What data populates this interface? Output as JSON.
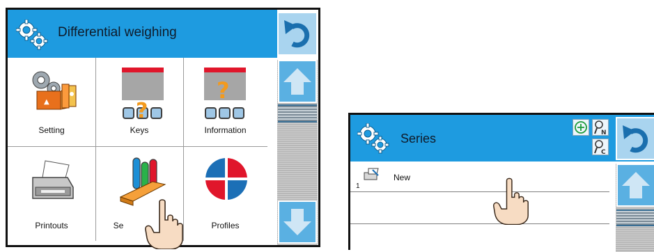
{
  "left_screen": {
    "title": "Differential weighing",
    "tiles": [
      {
        "label": "Setting",
        "icon": "setting-icon"
      },
      {
        "label": "Keys",
        "icon": "keys-icon"
      },
      {
        "label": "Information",
        "icon": "information-icon"
      },
      {
        "label": "Printouts",
        "icon": "printer-icon"
      },
      {
        "label": "Se",
        "icon": "series-test-tubes-icon"
      },
      {
        "label": "Profiles",
        "icon": "profiles-icon"
      }
    ]
  },
  "right_screen": {
    "title": "Series",
    "rows": [
      {
        "number": "1",
        "name": "New",
        "icon": "series-item-icon"
      }
    ],
    "small_buttons": [
      {
        "letter": "N",
        "icon": "search-name-icon"
      },
      {
        "letter": "C",
        "icon": "search-code-icon"
      }
    ]
  },
  "colors": {
    "title_bar": "#1e9be0",
    "button_blue": "#5ab0e2",
    "return_button": "#a9d4ef",
    "grid_lines": "#9a9a9a"
  }
}
